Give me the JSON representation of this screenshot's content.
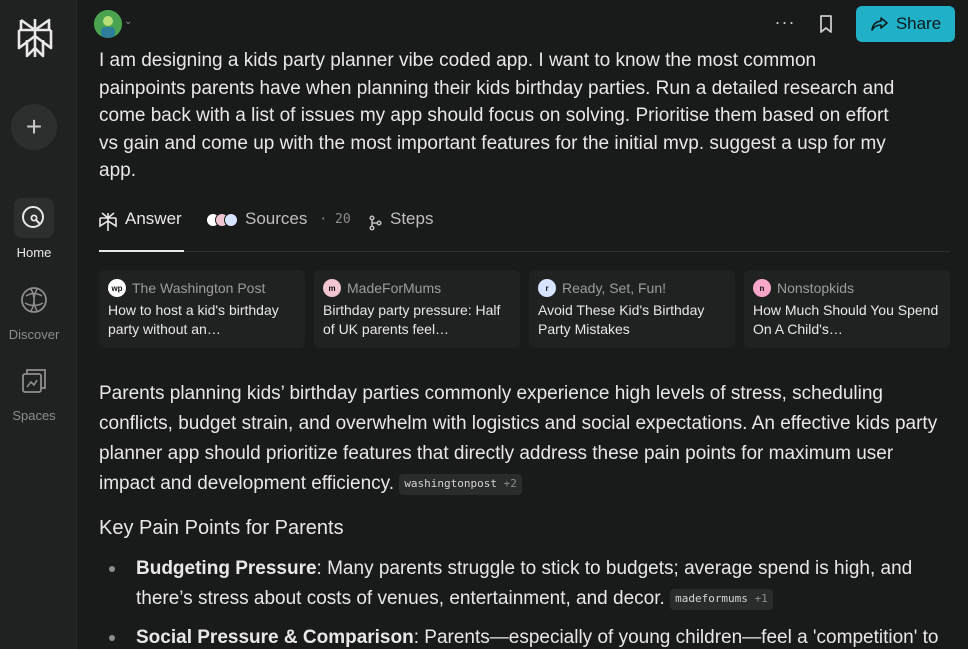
{
  "sidebar": {
    "new_label": "+",
    "items": [
      {
        "label": "Home",
        "icon": "home-search-icon"
      },
      {
        "label": "Discover",
        "icon": "globe-icon"
      },
      {
        "label": "Spaces",
        "icon": "spaces-icon"
      }
    ]
  },
  "topbar": {
    "more_label": "···",
    "share_label": "Share"
  },
  "query": "I am designing a kids party planner vibe coded app. I want to know the most common painpoints parents have when planning their kids birthday parties. Run a detailed research and come back with a list of issues my app should focus on solving. Prioritise them based on effort vs gain and come  up with the most important features for the initial mvp. suggest a usp for my app.",
  "tabs": {
    "answer": "Answer",
    "sources": "Sources",
    "sources_count": "· 20",
    "steps": "Steps"
  },
  "sources": [
    {
      "name": "The Washington Post",
      "title": "How to host a kid's birthday party without an…",
      "fav": "wp",
      "color": "#ffffff"
    },
    {
      "name": "MadeForMums",
      "title": "Birthday party pressure: Half of UK parents feel…",
      "fav": "m",
      "color": "#f1c6d0"
    },
    {
      "name": "Ready, Set, Fun!",
      "title": "Avoid These Kid's Birthday Party Mistakes",
      "fav": "r",
      "color": "#d6e4ff"
    },
    {
      "name": "Nonstopkids",
      "title": "How Much Should You Spend On A Child's…",
      "fav": "n",
      "color": "#f7a8c8"
    }
  ],
  "answer": {
    "intro": "Parents planning kids’ birthday parties commonly experience high levels of stress, scheduling conflicts, budget strain, and overwhelm with logistics and social expectations. An effective kids party planner app should prioritize features that directly address these pain points for maximum user impact and development efficiency.",
    "intro_cite": "washingtonpost",
    "intro_cite_plus": "+2",
    "heading": "Key Pain Points for Parents",
    "points": [
      {
        "title": "Budgeting Pressure",
        "text": ": Many parents struggle to stick to budgets; average spend is high, and there’s stress about costs of venues, entertainment, and decor.",
        "cite": "madeformums",
        "cite_plus": "+1"
      },
      {
        "title": "Social Pressure & Comparison",
        "text": ": Parents—especially of young children—feel a 'competition' to",
        "cite": "",
        "cite_plus": ""
      }
    ]
  }
}
